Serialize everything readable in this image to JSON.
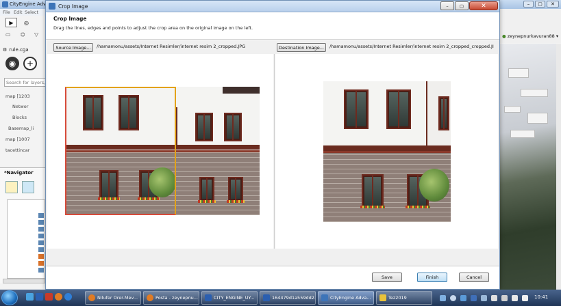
{
  "background_app": {
    "title": "CityEngine Advar",
    "menu": [
      "File",
      "Edit",
      "Select"
    ],
    "tab_label": "rule.cga",
    "search_placeholder": "Search for layers,",
    "tree_items": [
      "map [1203",
      "Networ",
      "Blocks",
      "Basemap_li",
      "map [1007",
      "tacettincar"
    ],
    "navigator_title": "*Navigator",
    "user": "zeynepnurkavuran88"
  },
  "dialog": {
    "title": "Crop Image",
    "heading": "Crop Image",
    "description": "Drag the lines, edges and points to adjust the crop area on the original image on the left.",
    "source_button": "Source Image...",
    "source_path": "/hamamonu/assets/Internet Resimler/internet resim 2_cropped.JPG",
    "destination_button": "Destination Image...",
    "destination_path": "/hamamonu/assets/Internet Resimler/internet resim 2_cropped_cropped.JI",
    "close_glyph": "✕",
    "buttons": {
      "save": "Save",
      "finish": "Finish",
      "cancel": "Cancel"
    }
  },
  "taskbar": {
    "items": [
      {
        "label": "Nilufer Orer-Mev...",
        "color": "#e07b24"
      },
      {
        "label": "Posta - zeynepnu...",
        "color": "#e07b24"
      },
      {
        "label": "CITY_ENGINE_UY...",
        "color": "#2b5fb0"
      },
      {
        "label": "164479d1a559dd2...",
        "color": "#2b5fb0"
      },
      {
        "label": "CityEngine Adva...",
        "color": "#3d74b8"
      },
      {
        "label": "Tez2019",
        "color": "#e8c23a"
      }
    ],
    "clock": "10:41"
  },
  "colors": {
    "crop_frame": "#e3a21a",
    "crop_frame_left": "#d64a3a",
    "accent": "#3d74b8"
  }
}
